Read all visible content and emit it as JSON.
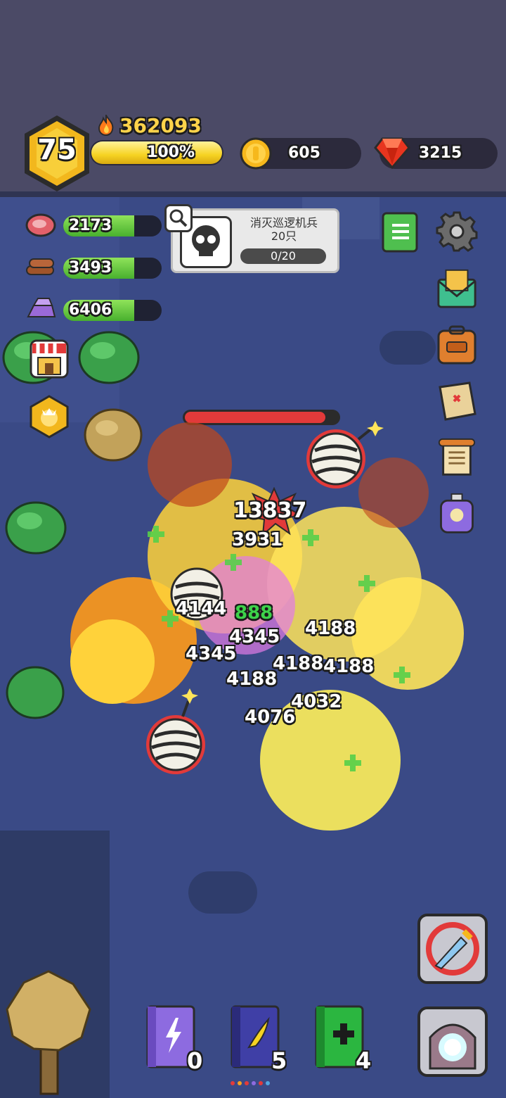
{
  "player": {
    "level": "75",
    "power": "362093",
    "xp_label": "100%",
    "xp_fraction": 1.0
  },
  "currencies": {
    "gold": "605",
    "gems": "3215"
  },
  "resources": [
    {
      "name": "meat",
      "value": "2173",
      "fill": 0.72
    },
    {
      "name": "wood",
      "value": "3493",
      "fill": 0.72
    },
    {
      "name": "ingot",
      "value": "6406",
      "fill": 0.72
    }
  ],
  "quest": {
    "title": "消灭巡逻机兵\n20只",
    "progress": "0/20"
  },
  "damage_numbers": [
    {
      "text": "13837",
      "kind": "crit"
    },
    {
      "text": "3931",
      "kind": "white"
    },
    {
      "text": "4144",
      "kind": "white"
    },
    {
      "text": "888",
      "kind": "green"
    },
    {
      "text": "4188",
      "kind": "white"
    },
    {
      "text": "4345",
      "kind": "white"
    },
    {
      "text": "4345",
      "kind": "white"
    },
    {
      "text": "4188",
      "kind": "white"
    },
    {
      "text": "4188",
      "kind": "white"
    },
    {
      "text": "4188",
      "kind": "white"
    },
    {
      "text": "4032",
      "kind": "white"
    },
    {
      "text": "4076",
      "kind": "white"
    }
  ],
  "skill_books": [
    {
      "name": "lightning-book",
      "count": "0",
      "color": "#8d6be0"
    },
    {
      "name": "wing-book",
      "count": "5",
      "color": "#3f3fa6"
    },
    {
      "name": "heal-book",
      "count": "4",
      "color": "#2bb640"
    }
  ],
  "side_icons": [
    "guide-book-icon",
    "settings-gear-icon",
    "mail-icon",
    "backpack-icon",
    "treasure-map-icon",
    "scroll-icon",
    "potion-bottle-icon"
  ],
  "colors": {
    "accent_gold": "#f6c21e",
    "xp_yellow": "#f6d322",
    "gem_red": "#e7351f",
    "health_green": "#48b02e"
  }
}
